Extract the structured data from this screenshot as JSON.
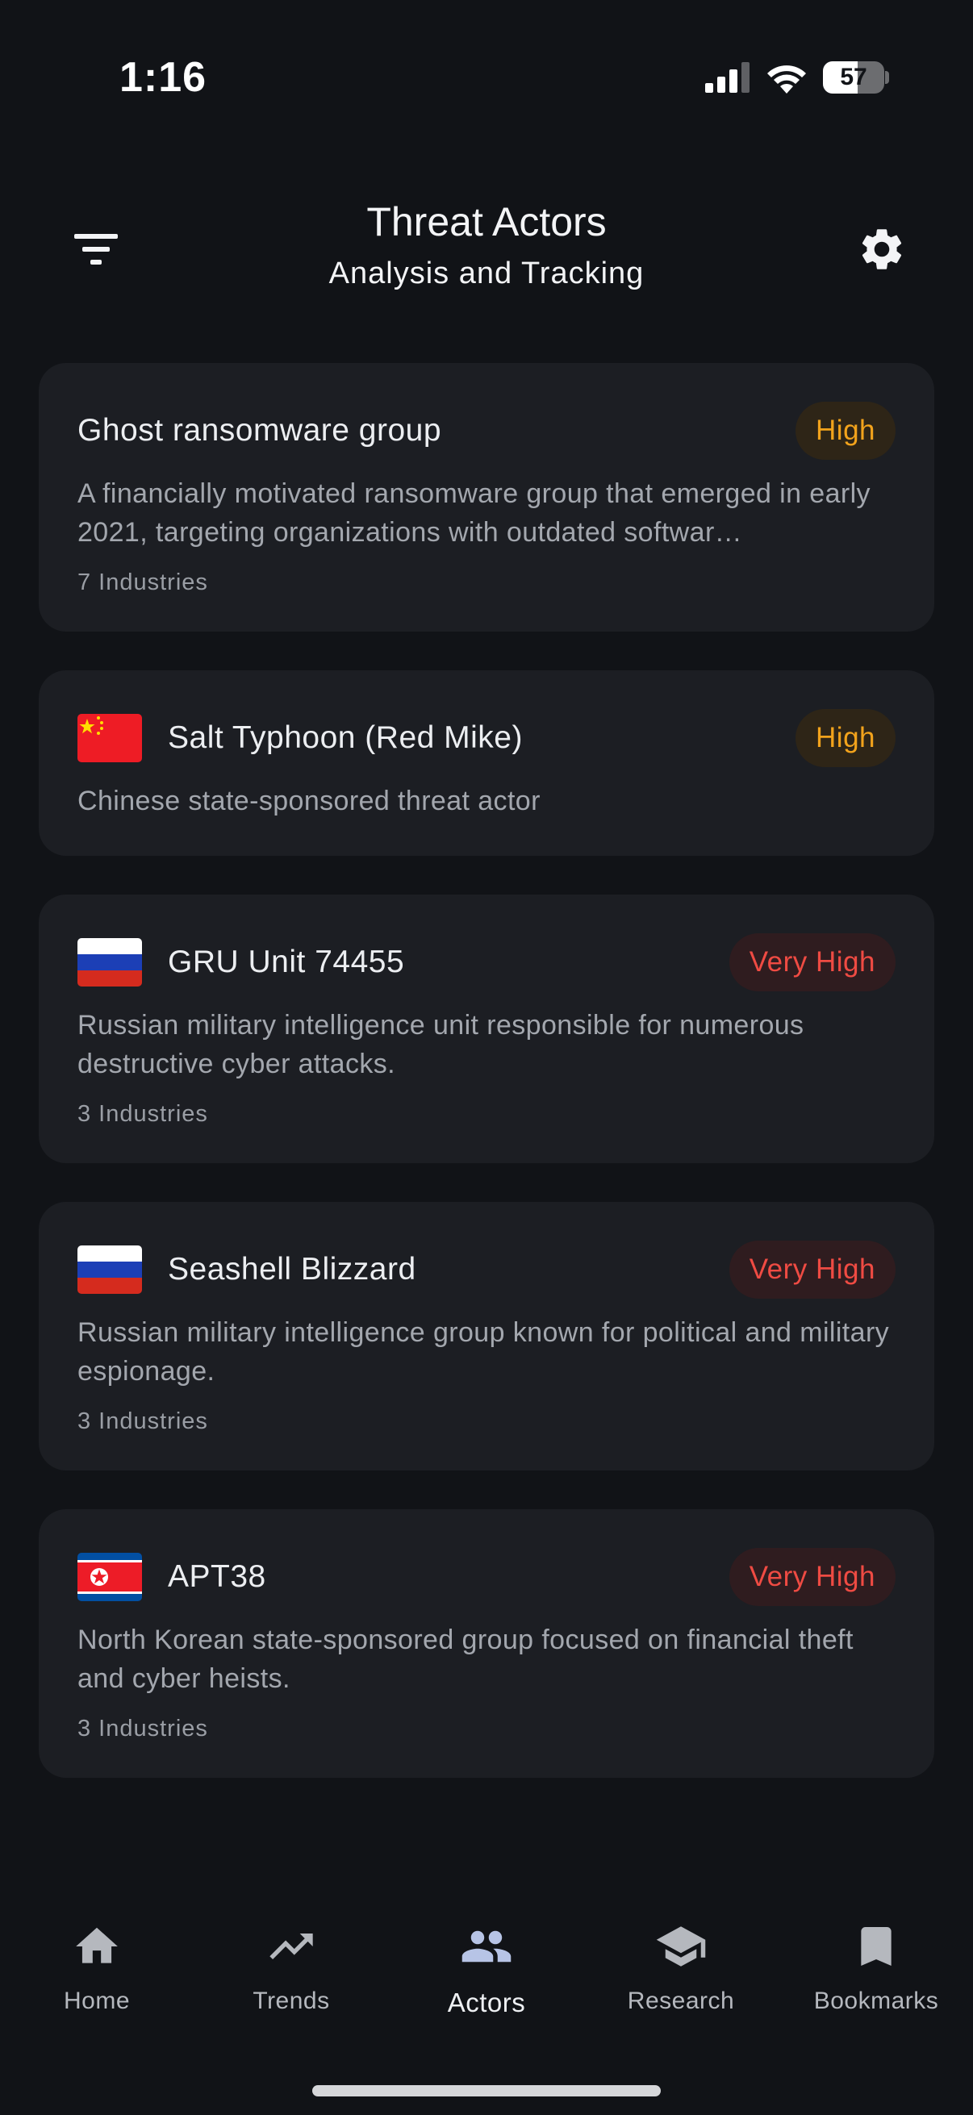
{
  "status_bar": {
    "time": "1:16",
    "battery": "57",
    "battery_level": 0.57,
    "icons": [
      "signal-icon",
      "wifi-icon",
      "battery-icon"
    ]
  },
  "header": {
    "title": "Threat Actors",
    "subtitle": "Analysis and Tracking",
    "left_icon": "filter-icon",
    "right_icon": "gear-icon"
  },
  "actors": [
    {
      "name": "Ghost ransomware group",
      "flag": null,
      "risk": "High",
      "description": "A financially motivated ransomware group that emerged in early 2021, targeting organizations with outdated softwar…",
      "industries": "7 Industries"
    },
    {
      "name": "Salt Typhoon (Red Mike)",
      "flag": "china-flag-icon",
      "risk": "High",
      "description": "Chinese state-sponsored threat actor",
      "industries": ""
    },
    {
      "name": "GRU Unit 74455",
      "flag": "russia-flag-icon",
      "risk": "Very High",
      "description": "Russian military intelligence unit responsible for numerous destructive cyber attacks.",
      "industries": "3 Industries"
    },
    {
      "name": "Seashell Blizzard",
      "flag": "russia-flag-icon",
      "risk": "Very High",
      "description": "Russian military intelligence group known for political and military espionage.",
      "industries": "3 Industries"
    },
    {
      "name": "APT38",
      "flag": "north-korea-flag-icon",
      "risk": "Very High",
      "description": "North Korean state-sponsored group focused on financial theft and cyber heists.",
      "industries": "3 Industries"
    }
  ],
  "nav": {
    "items": [
      {
        "label": "Home",
        "icon": "home-icon"
      },
      {
        "label": "Trends",
        "icon": "trending-up-icon"
      },
      {
        "label": "Actors",
        "icon": "people-icon",
        "active": true
      },
      {
        "label": "Research",
        "icon": "graduation-cap-icon"
      },
      {
        "label": "Bookmarks",
        "icon": "bookmark-icon"
      }
    ]
  },
  "colors": {
    "background": "#111317",
    "card": "#1c1e23",
    "high": "#f2a31c",
    "very_high": "#ef4b43"
  }
}
